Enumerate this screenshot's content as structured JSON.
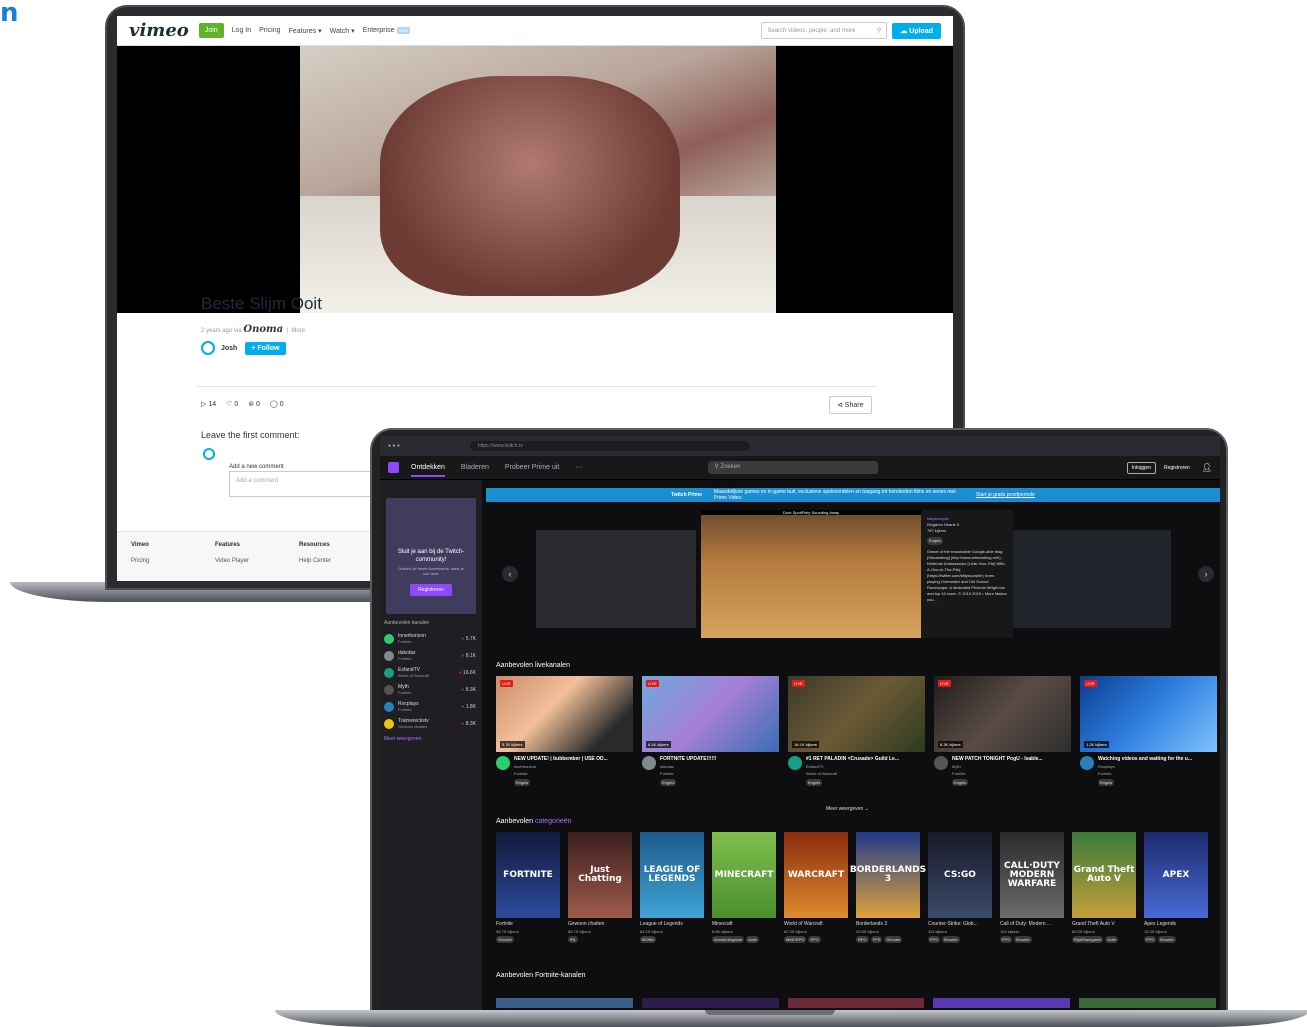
{
  "corner_text": "n",
  "vimeo": {
    "logo": "vimeo",
    "join": "Join",
    "nav": [
      "Log In",
      "Pricing",
      "Features ▾",
      "Watch ▾",
      "Enterprise"
    ],
    "enterprise_badge": "NEW",
    "search_placeholder": "Search videos, people, and more",
    "upload": "Upload",
    "title": "Beste Slijm Ooit",
    "meta": "2 years ago via",
    "meta_brand": "Onoma",
    "meta_more": "More",
    "user": "Josh",
    "follow": "+ Follow",
    "stats": [
      "▷ 14",
      "♡ 0",
      "⊜ 0",
      "◯ 0"
    ],
    "share": "⊲ Share",
    "leave_comment": "Leave the first comment:",
    "add_comment_label": "Add a new comment",
    "add_comment_placeholder": "Add a comment",
    "footer": [
      {
        "head": "Vimeo",
        "item": "Pricing"
      },
      {
        "head": "Features",
        "item": "Video Player"
      },
      {
        "head": "Resources",
        "item": "Help Center"
      }
    ]
  },
  "twitch": {
    "url": "https://www.twitch.tv",
    "tabs": [
      "Ontdekken",
      "Bladeren",
      "Probeer Prime uit",
      "···"
    ],
    "search_placeholder": "Zoeken",
    "login": "Inloggen",
    "register": "Registreren",
    "prime_banner": {
      "brand": "Twitch Prime",
      "text": "Maandelijkse games en in-game buit, exclusieve spelvoordelen en toegang tot honderden films en series met Prime Video.",
      "cta": "Start je gratis proefperiode"
    },
    "sidebar": {
      "join_title": "Sluit je aan bij de Twitch-community!",
      "join_sub": "Ontdek de beste livestreams, waar je ook bent.",
      "register": "Registreren",
      "section": "Aanbevolen kanalen",
      "channels": [
        {
          "name": "Innerhorizon",
          "game": "Fortnite",
          "viewers": "5.7K",
          "color": "#2ecc71"
        },
        {
          "name": "dakotaz",
          "game": "Fortnite",
          "viewers": "8.1K",
          "color": "#7f8c8d"
        },
        {
          "name": "EsfandTV",
          "game": "World of Warcraft",
          "viewers": "16.6K",
          "color": "#16a085"
        },
        {
          "name": "Myth",
          "game": "Fortnite",
          "viewers": "8.3K",
          "color": "#555"
        },
        {
          "name": "Rocplays",
          "game": "Fortnite",
          "viewers": "1.8K",
          "color": "#2980b9"
        },
        {
          "name": "Trainwreckstv",
          "game": "Gewoon chatten",
          "viewers": "8.3K",
          "color": "#f1c40f"
        }
      ],
      "more": "Meer weergeven"
    },
    "carousel": {
      "top_label": "Dont SpotiFinty Sounding Away",
      "streamer_name": "kittyssunpile",
      "streamer_game": "Kingdom Hearts 3",
      "streamer_viewers": "787 kijkers",
      "streamer_lang": "Engels",
      "streamer_desc": "Owner of the reasonable Google-able blog [Streamblog] (http://www.streamblog.net/), Nintendo Ambassador [I-Ate-Your-File] With-A-One-In-The-File](https://twitter.com/kittyssunpile) loves playing Overwatch and Old School Runescape. A dedicated Phoenix Wright fan and top 10 racer. © 2019 2019 • More Makes you..."
    },
    "live_section_prefix": "Aanbevolen",
    "live_section": "livekanalen",
    "live": [
      {
        "title": "NEW UPDATE! | bubbember | USE OD...",
        "name": "innerhorizon",
        "game": "Fortnite",
        "viewers": "5.7K kijkers",
        "tag": "Engels",
        "thumb": "linear-gradient(135deg,#c98b6b,#f4c09a 40%,#2a2a2a 80%)",
        "av": "#2ecc71"
      },
      {
        "title": "FORTNITE UPDATE!!!!!!",
        "name": "dakotaz",
        "game": "Fortnite",
        "viewers": "8.1K kijkers",
        "tag": "Engels",
        "thumb": "linear-gradient(135deg,#6fa8dc,#a57fd6 50%,#3a6db5)",
        "av": "#7f8c8d"
      },
      {
        "title": "#1 RET PALADIN <Crusade> Guild Le...",
        "name": "EsfandTV",
        "game": "World of Warcraft",
        "viewers": "16.1K kijkers",
        "tag": "Engels",
        "thumb": "linear-gradient(135deg,#3b3a2a,#6b5a35 50%,#2d3a1f)",
        "av": "#16a085"
      },
      {
        "title": "NEW PATCH TONIGHT PogU - Isable...",
        "name": "Myth",
        "game": "Fortnite",
        "viewers": "8.3K kijkers",
        "tag": "Engels",
        "thumb": "linear-gradient(135deg,#1e1e1e,#5a4b44 50%,#2d2d2d)",
        "av": "#555"
      },
      {
        "title": "Watching videos and waiting for the u...",
        "name": "Rocplays",
        "game": "Fortnite",
        "viewers": "1.2K kijkers",
        "tag": "Engels",
        "thumb": "linear-gradient(135deg,#0b3d91,#2f7fe0 50%,#7ec2ff)",
        "av": "#2980b9"
      }
    ],
    "more_view": "Meer weergeven ⌄",
    "cat_section_prefix": "Aanbevolen",
    "cat_section": "categorieën",
    "categories": [
      {
        "name": "Fortnite",
        "viewers": "96.7K kijkers",
        "tags": [
          "Shooter"
        ],
        "art": "FORTNITE",
        "bg": "linear-gradient(#111a3d,#2c4b9b)"
      },
      {
        "name": "Gewoon chatten",
        "viewers": "86.7K kijkers",
        "tags": [
          "IRL"
        ],
        "art": "Just Chatting",
        "bg": "linear-gradient(#3b1f1f,#a05b4c)"
      },
      {
        "name": "League of Legends",
        "viewers": "84.2K kijkers",
        "tags": [
          "MOBA"
        ],
        "art": "LEAGUE OF LEGENDS",
        "bg": "linear-gradient(#1d5a8a,#3fa4d6)"
      },
      {
        "name": "Minecraft",
        "viewers": "8.8K kijkers",
        "tags": [
          "Avonturengame",
          "Actie"
        ],
        "art": "MINECRAFT",
        "bg": "linear-gradient(#7fbf4e,#4b8f2e)"
      },
      {
        "name": "World of Warcraft",
        "viewers": "62.3K kijkers",
        "tags": [
          "MMORPG",
          "RPG"
        ],
        "art": "WARCRAFT",
        "bg": "linear-gradient(#8a2c0f,#e08a2e)"
      },
      {
        "name": "Borderlands 3",
        "viewers": "20.8K kijkers",
        "tags": [
          "RPG",
          "FPS",
          "Shooter"
        ],
        "art": "BORDERLANDS 3",
        "bg": "linear-gradient(#1e3a8a,#e0a23a)"
      },
      {
        "name": "Counter-Strike: Glob...",
        "viewers": "114 kijkers",
        "tags": [
          "FPS",
          "Shooter"
        ],
        "art": "CS:GO",
        "bg": "linear-gradient(#1a1a2a,#3a4a6a)"
      },
      {
        "name": "Call of Duty: Modern ...",
        "viewers": "104 kijkers",
        "tags": [
          "FPS",
          "Shooter"
        ],
        "art": "CALL·DUTY MODERN WARFARE",
        "bg": "linear-gradient(#2b2b2b,#6b6b6b)"
      },
      {
        "name": "Grand Theft Auto V",
        "viewers": "80.5K kijkers",
        "tags": [
          "Rijd/Racegame",
          "Actie"
        ],
        "art": "Grand Theft Auto V",
        "bg": "linear-gradient(#3a7a3a,#c4a03a)"
      },
      {
        "name": "Apex Legends",
        "viewers": "15.3K kijkers",
        "tags": [
          "FPS",
          "Shooter"
        ],
        "art": "APEX",
        "bg": "linear-gradient(#1e2a6e,#4a6ad6)"
      }
    ],
    "fortnite_section_prefix": "Aanbevolen",
    "fortnite_section": "Fortnite-kanalen"
  }
}
